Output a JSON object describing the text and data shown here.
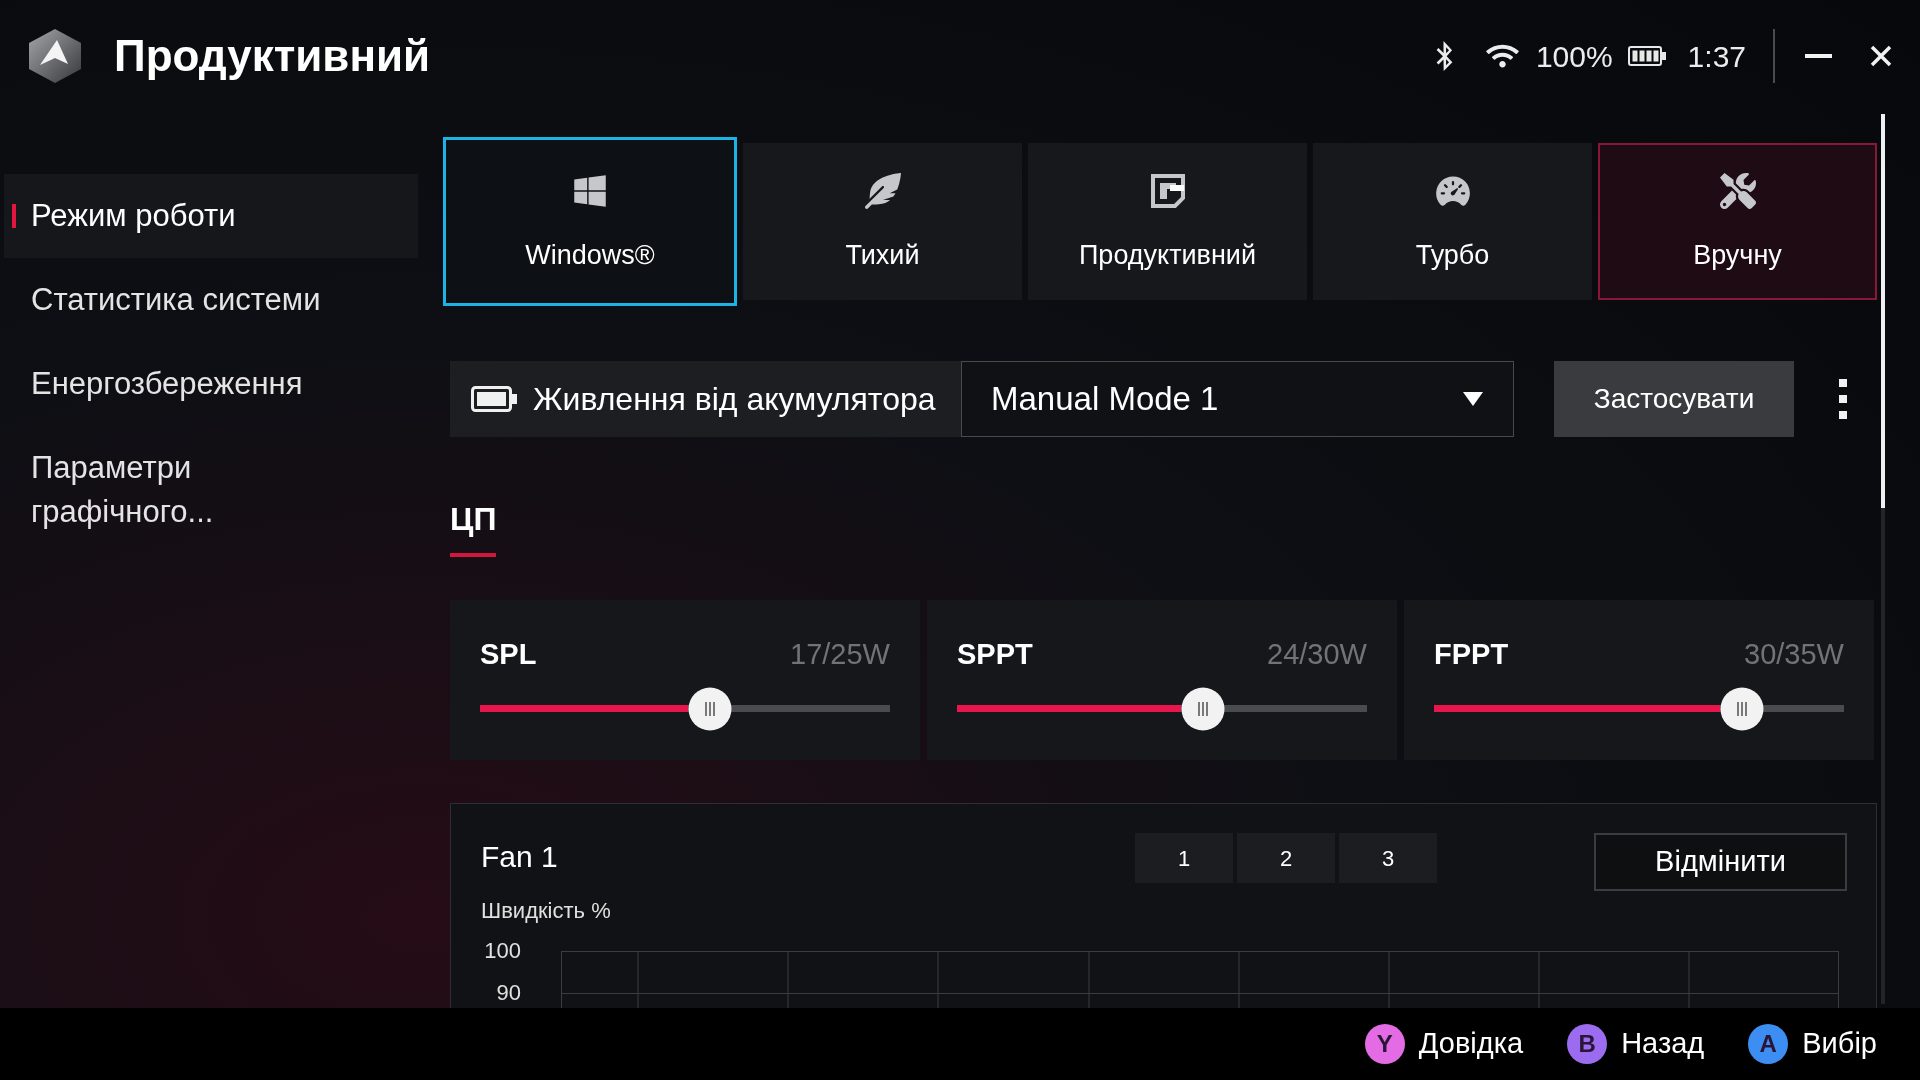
{
  "header": {
    "title": "Продуктивний",
    "battery_percent": "100%",
    "time": "1:37"
  },
  "sidebar": {
    "items": [
      {
        "label": "Режим роботи",
        "selected": true
      },
      {
        "label": "Статистика системи",
        "selected": false
      },
      {
        "label": "Енергозбереження",
        "selected": false
      },
      {
        "label": "Параметри графічного...",
        "selected": false
      }
    ]
  },
  "modes": [
    {
      "kind": "windows",
      "label": "Windows®",
      "focused": true,
      "selected": false
    },
    {
      "kind": "silent",
      "label": "Тихий",
      "focused": false,
      "selected": false
    },
    {
      "kind": "performance",
      "label": "Продуктивний",
      "focused": false,
      "selected": false
    },
    {
      "kind": "turbo",
      "label": "Турбо",
      "focused": false,
      "selected": false
    },
    {
      "kind": "manual",
      "label": "Вручну",
      "focused": false,
      "selected": true
    }
  ],
  "profile_bar": {
    "power_source": "Живлення від акумулятора",
    "profile": {
      "value": "Manual Mode 1"
    },
    "apply_button": "Застосувати"
  },
  "section_tabs": [
    {
      "label": "ЦП",
      "selected": true
    }
  ],
  "power_limits": [
    {
      "name": "SPL",
      "reading": "17/25W",
      "level": 0.56
    },
    {
      "name": "SPPT",
      "reading": "24/30W",
      "level": 0.6
    },
    {
      "name": "FPPT",
      "reading": "30/35W",
      "level": 0.75
    }
  ],
  "fan": {
    "title": "Fan 1",
    "tabs": [
      {
        "label": "1",
        "selected": false
      },
      {
        "label": "2",
        "selected": false
      },
      {
        "label": "3",
        "selected": false
      }
    ],
    "reset_button": "Відмінити",
    "axis_title": "Швидкість %",
    "y_ticks": [
      "100",
      "90"
    ]
  },
  "footer": {
    "hints": [
      {
        "key": "Y",
        "label": "Довідка",
        "color": "#e36be3"
      },
      {
        "key": "B",
        "label": "Назад",
        "color": "#9c6cf0"
      },
      {
        "key": "A",
        "label": "Вибір",
        "color": "#3d8ef2"
      }
    ]
  }
}
